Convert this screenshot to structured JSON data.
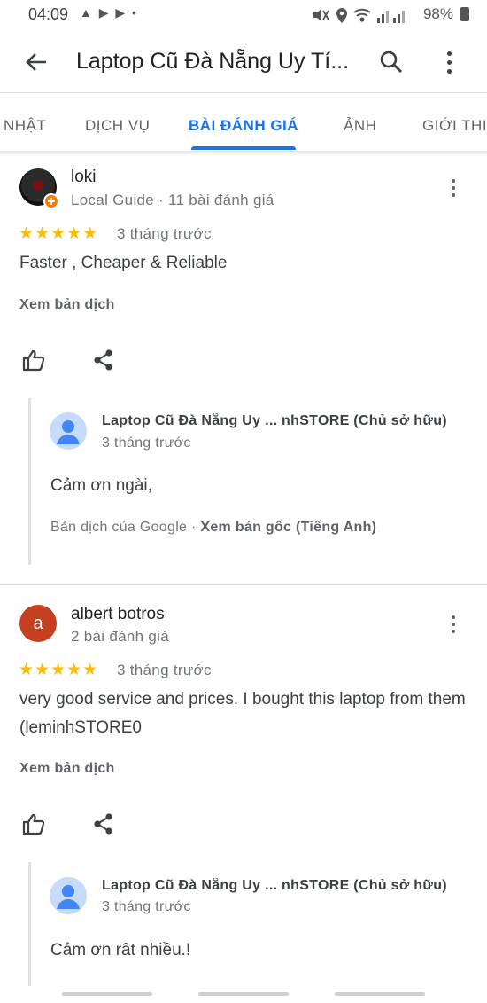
{
  "status_bar": {
    "time": "04:09",
    "notif_icons": "▲ ▶ ▶ •",
    "battery": "98%",
    "icons": [
      "mute-icon",
      "location-icon",
      "wifi-icon",
      "signal-icon",
      "battery-icon"
    ]
  },
  "appbar": {
    "title": "Laptop Cũ Đà Nẵng Uy Tí...",
    "icons": [
      "back-arrow-icon",
      "search-icon",
      "more-vert-icon"
    ]
  },
  "tabs": [
    "NHẬT",
    "DỊCH VỤ",
    "BÀI ĐÁNH GIÁ",
    "ẢNH",
    "GIỚI THI"
  ],
  "active_tab": "BÀI ĐÁNH GIÁ",
  "reviews": [
    {
      "author": "loki",
      "meta": "Local Guide · 11 bài đánh giá",
      "stars": "★★★★★",
      "rating": 5,
      "date": "3 tháng trước",
      "text": "Faster , Cheaper & Reliable",
      "translate": "Xem bản dịch",
      "reply": {
        "owner": "Laptop Cũ Đà Nẵng Uy ...  nhSTORE (Chủ sở hữu)",
        "date": "3 tháng trước",
        "text": "Cảm ơn ngài,",
        "translated_by": "Bản dịch của Google · ",
        "see_original": "Xem bản gốc (Tiếng Anh)"
      }
    },
    {
      "author": "albert botros",
      "avatar_letter": "a",
      "meta": "2 bài đánh giá",
      "stars": "★★★★★",
      "rating": 5,
      "date": "3 tháng trước",
      "text": "very good service and prices.  I bought this laptop from them (leminhSTORE0",
      "translate": "Xem bản dịch",
      "reply": {
        "owner": "Laptop Cũ Đà Nẵng Uy ...  nhSTORE (Chủ sở hữu)",
        "date": "3 tháng trước",
        "text": "Cảm ơn rât nhiều.!"
      }
    }
  ],
  "colors": {
    "accent": "#1a73e8",
    "star": "#fbbc04",
    "avatar_albert": "#c5401e"
  }
}
